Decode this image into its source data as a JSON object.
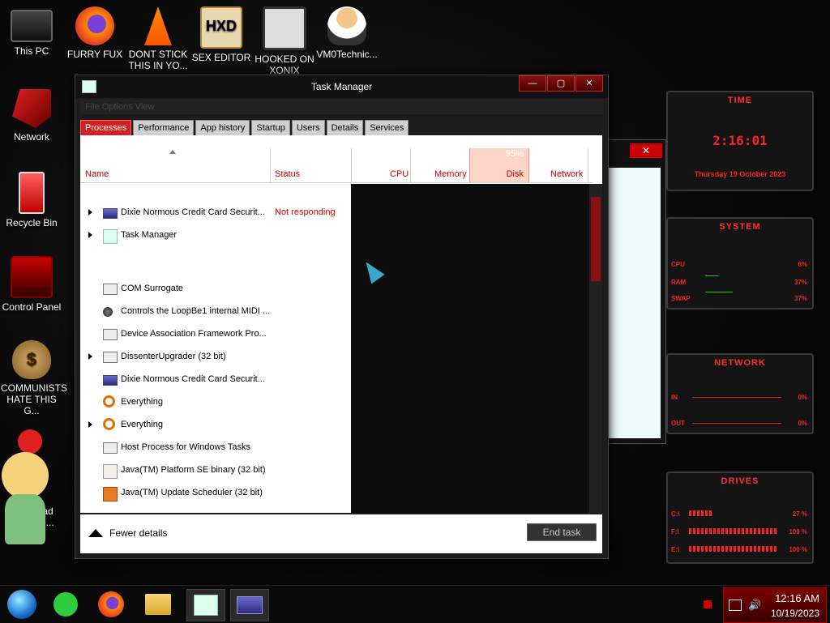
{
  "desktop": {
    "icons": [
      {
        "label": "This PC"
      },
      {
        "label": "FURRY FUX"
      },
      {
        "label": "DONT STICK THIS IN YO..."
      },
      {
        "label": "SEX EDITOR"
      },
      {
        "label": "HOOKED ON XONIX"
      },
      {
        "label": "VM0Technic..."
      },
      {
        "label": "Network"
      },
      {
        "label": "Recycle Bin"
      },
      {
        "label": "Control Panel"
      },
      {
        "label": "COMMUNISTS HATE THIS G..."
      },
      {
        "label": "Download Black Ali..."
      }
    ]
  },
  "taskmanager": {
    "title": "Task Manager",
    "menu": "File   Options   View",
    "tabs": [
      "Processes",
      "Performance",
      "App history",
      "Startup",
      "Users",
      "Details",
      "Services"
    ],
    "columns": {
      "name": "Name",
      "status": "Status",
      "cpu": "CPU",
      "memory": "Memory",
      "disk_pct": "95%",
      "disk": "Disk",
      "network": "Network"
    },
    "rows": [
      {
        "name": "Dixie Normous Credit Card Securit...",
        "status": "Not responding",
        "expand": true,
        "icon": "app-window-icon"
      },
      {
        "name": "Task Manager",
        "status": "",
        "expand": true,
        "icon": "task-manager-icon"
      },
      {
        "name": "COM Surrogate",
        "status": "",
        "expand": false,
        "icon": "service-icon"
      },
      {
        "name": "Controls the LoopBe1 internal MIDI ...",
        "status": "",
        "expand": false,
        "icon": "midi-icon"
      },
      {
        "name": "Device Association Framework Pro...",
        "status": "",
        "expand": false,
        "icon": "service-icon"
      },
      {
        "name": "DissenterUpgrader (32 bit)",
        "status": "",
        "expand": true,
        "icon": "service-icon"
      },
      {
        "name": "Dixie Normous Credit Card Securit...",
        "status": "",
        "expand": false,
        "icon": "app-window-icon"
      },
      {
        "name": "Everything",
        "status": "",
        "expand": false,
        "icon": "search-icon"
      },
      {
        "name": "Everything",
        "status": "",
        "expand": true,
        "icon": "search-icon"
      },
      {
        "name": "Host Process for Windows Tasks",
        "status": "",
        "expand": false,
        "icon": "service-icon"
      },
      {
        "name": "Java(TM) Platform SE binary (32 bit)",
        "status": "",
        "expand": false,
        "icon": "java-icon"
      },
      {
        "name": "Java(TM) Update Scheduler (32 bit)",
        "status": "",
        "expand": false,
        "icon": "java-update-icon"
      }
    ],
    "fewer_details": "Fewer details",
    "end_task": "End task"
  },
  "gadget": {
    "time_title": "TIME",
    "time": "2:16:01",
    "date": "Thursday 19 October 2023",
    "system_title": "SYSTEM",
    "cpu_label": "CPU",
    "cpu_val": "6%",
    "ram_label": "RAM",
    "ram_val": "37%",
    "swap_label": "SWAP",
    "swap_val": "37%",
    "network_title": "NETWORK",
    "in_label": "IN",
    "in_val": "0%",
    "out_label": "OUT",
    "out_val": "0%",
    "drives_title": "DRIVES",
    "drives": [
      {
        "label": "C:\\",
        "val": "27 %"
      },
      {
        "label": "F:\\",
        "val": "100 %"
      },
      {
        "label": "E:\\",
        "val": "100 %"
      }
    ]
  },
  "taskbar": {
    "time": "12:16 AM",
    "date": "10/19/2023"
  },
  "colors": {
    "accent": "#d42020",
    "status_red": "#dd0000",
    "gadget_red": "#ff2020"
  }
}
